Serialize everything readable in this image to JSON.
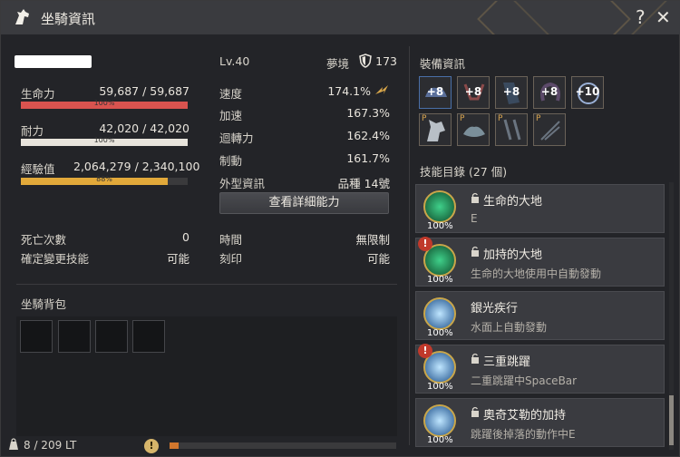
{
  "title": "坐騎資訊",
  "title_buttons": {
    "help": "?",
    "close": "✕"
  },
  "left": {
    "name": "",
    "stats": [
      {
        "label": "生命力",
        "value": "59,687 / 59,687",
        "pct_label": "100%",
        "fill": 1.0,
        "color": "#d9534f"
      },
      {
        "label": "耐力",
        "value": "42,020 / 42,020",
        "pct_label": "100%",
        "fill": 1.0,
        "color": "#e8e4dc"
      },
      {
        "label": "經驗值",
        "value": "2,064,279 / 2,340,100",
        "pct_label": "88%",
        "fill": 0.88,
        "color": "#e2a93a"
      }
    ],
    "misc": [
      {
        "label": "死亡次數",
        "value": "0"
      },
      {
        "label": "確定變更技能",
        "value": "可能"
      }
    ]
  },
  "middle": {
    "level": "Lv.40",
    "dream_label": "夢境",
    "dream_value": "173",
    "stats": [
      {
        "label": "速度",
        "value": "174.1%"
      },
      {
        "label": "加速",
        "value": "167.3%"
      },
      {
        "label": "迴轉力",
        "value": "162.4%"
      },
      {
        "label": "制動",
        "value": "161.7%"
      },
      {
        "label": "外型資訊",
        "value": "品種 14號"
      }
    ],
    "detail_button": "查看詳細能力",
    "misc": [
      {
        "label": "時間",
        "value": "無限制"
      },
      {
        "label": "刻印",
        "value": "可能"
      }
    ]
  },
  "bag": {
    "title": "坐騎背包",
    "weight": "8 / 209 LT",
    "weight_fill": 0.04
  },
  "equipment": {
    "title": "裝備資訊",
    "row1": [
      "+8",
      "+8",
      "+8",
      "+8",
      "+10"
    ],
    "row2": [
      "P",
      "P",
      "P",
      "P"
    ]
  },
  "skills": {
    "title": "技能目錄 (27 個)",
    "items": [
      {
        "name": "生命的大地",
        "desc": "E",
        "pct": "100%",
        "warn": false,
        "color": "#2f9b5a"
      },
      {
        "name": "加持的大地",
        "desc": "生命的大地使用中自動發動",
        "pct": "100%",
        "warn": true,
        "color": "#2f9b5a"
      },
      {
        "name": "銀光疾行",
        "desc": "水面上自動發動",
        "pct": "100%",
        "warn": false,
        "color": "#3c8fd6"
      },
      {
        "name": "三重跳躍",
        "desc": "二重跳躍中SpaceBar",
        "pct": "100%",
        "warn": true,
        "color": "#3c8fd6"
      },
      {
        "name": "奧奇艾勒的加持",
        "desc": "跳躍後掉落的動作中E",
        "pct": "100%",
        "warn": false,
        "color": "#3c8fd6"
      }
    ]
  }
}
